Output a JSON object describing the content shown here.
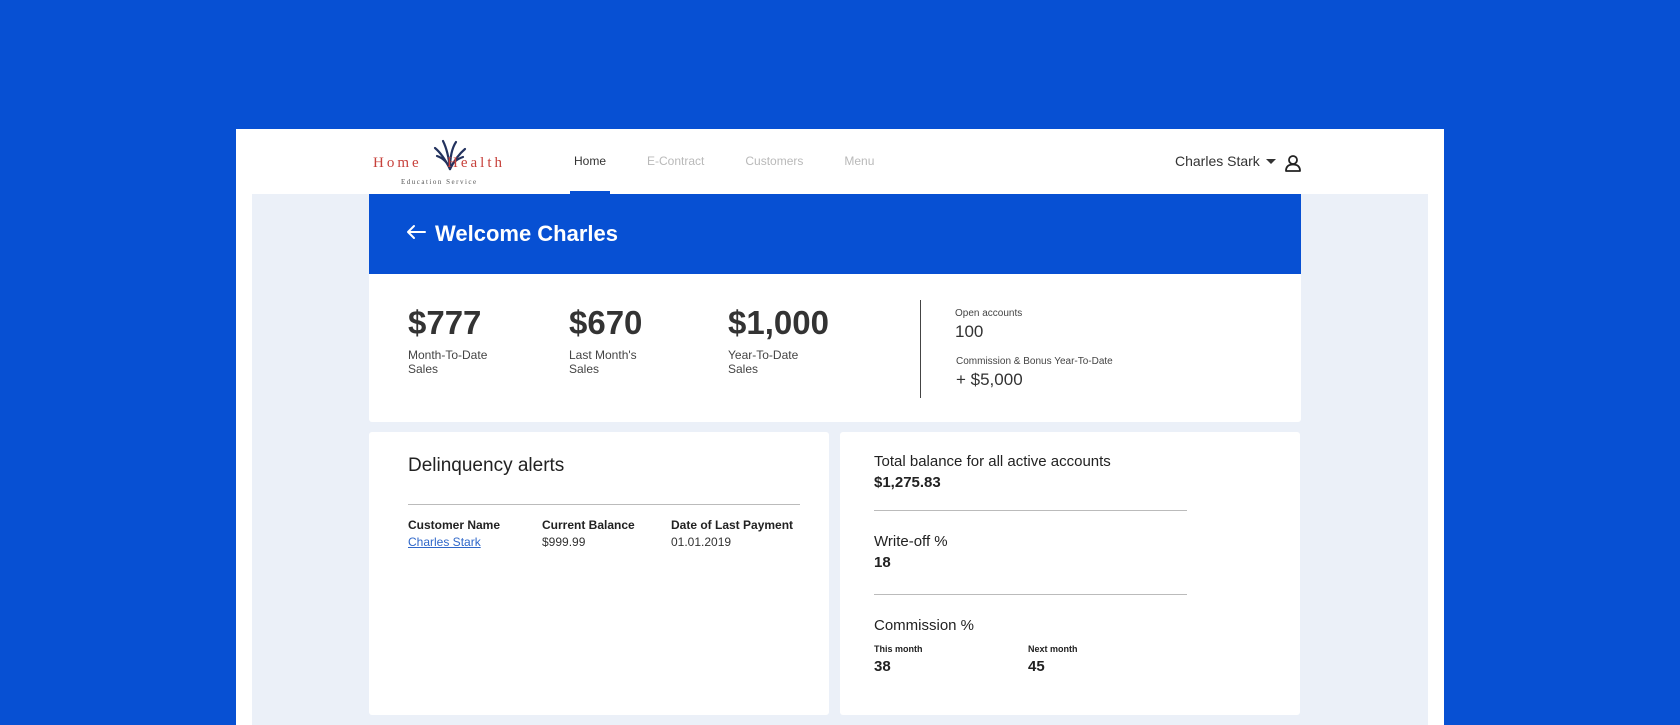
{
  "logo": {
    "word1": "Home",
    "word2": "Health",
    "subtitle": "Education Service"
  },
  "nav": [
    {
      "label": "Home",
      "active": true
    },
    {
      "label": "E-Contract"
    },
    {
      "label": "Customers"
    },
    {
      "label": "Menu"
    }
  ],
  "user": {
    "name": "Charles Stark"
  },
  "welcome": {
    "title": "Welcome Charles"
  },
  "stats": {
    "mtd": {
      "value": "$777",
      "label": "Month-To-Date Sales"
    },
    "last_month": {
      "value": "$670",
      "label": "Last Month's Sales"
    },
    "ytd": {
      "value": "$1,000",
      "label": "Year-To-Date Sales"
    },
    "open_accounts": {
      "label": "Open accounts",
      "value": "100"
    },
    "commission_ytd": {
      "label": "Commission & Bonus Year-To-Date",
      "value": "+ $5,000"
    }
  },
  "delinquency": {
    "title": "Delinquency alerts",
    "columns": [
      "Customer Name",
      "Current Balance",
      "Date of Last Payment"
    ],
    "rows": [
      {
        "customer": "Charles Stark",
        "balance": "$999.99",
        "date": "01.01.2019"
      }
    ]
  },
  "summary": {
    "total_balance": {
      "label": "Total balance for all active accounts",
      "value": "$1,275.83"
    },
    "writeoff": {
      "label": "Write-off %",
      "value": "18"
    },
    "commission": {
      "label": "Commission %",
      "this_month": {
        "label": "This month",
        "value": "38"
      },
      "next_month": {
        "label": "Next month",
        "value": "45"
      }
    }
  },
  "colors": {
    "brand_blue": "#0750d3",
    "logo_red": "#c7413b",
    "link": "#2f67c9"
  }
}
